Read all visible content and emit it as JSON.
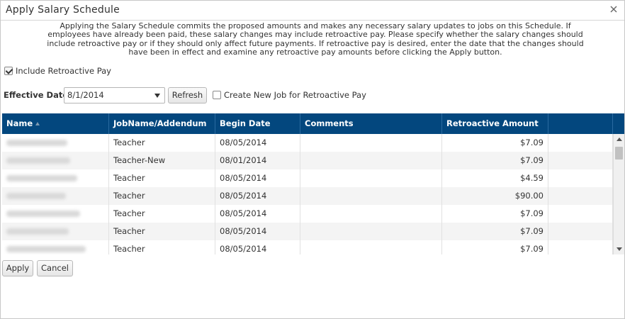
{
  "dialog": {
    "title": "Apply Salary Schedule",
    "close_icon": "close-icon"
  },
  "intro": {
    "line1": "Applying the Salary Schedule commits the proposed amounts and makes any necessary salary updates to jobs on this Schedule. If",
    "line2": "employees have already been paid, these salary changes may include retroactive pay. Please specify whether the salary changes should",
    "line3": "include retroactive pay or if they should only affect future payments. If retroactive pay is desired, enter the date that the changes should",
    "line4": "have been in effect and examine any retroactive pay amounts before clicking the Apply button."
  },
  "options": {
    "include_retro_label": "Include Retroactive Pay",
    "include_retro_checked": true,
    "effective_date_label": "Effective Date:",
    "effective_date_value": "8/1/2014",
    "refresh_label": "Refresh",
    "create_job_label": "Create New Job for Retroactive Pay",
    "create_job_checked": false
  },
  "grid": {
    "header_color": "#03477e",
    "columns": [
      {
        "label": "Name",
        "sorted": "ascending"
      },
      {
        "label": "JobName/Addendum"
      },
      {
        "label": "Begin Date"
      },
      {
        "label": "Comments"
      },
      {
        "label": "Retroactive Amount"
      }
    ],
    "rows": [
      {
        "name": "",
        "job": "Teacher",
        "begin": "08/05/2014",
        "comments": "",
        "amount": "$7.09"
      },
      {
        "name": "",
        "job": "Teacher-New",
        "begin": "08/01/2014",
        "comments": "",
        "amount": "$7.09"
      },
      {
        "name": "",
        "job": "Teacher",
        "begin": "08/05/2014",
        "comments": "",
        "amount": "$4.59"
      },
      {
        "name": "",
        "job": "Teacher",
        "begin": "08/05/2014",
        "comments": "",
        "amount": "$90.00"
      },
      {
        "name": "",
        "job": "Teacher",
        "begin": "08/05/2014",
        "comments": "",
        "amount": "$7.09"
      },
      {
        "name": "",
        "job": "Teacher",
        "begin": "08/05/2014",
        "comments": "",
        "amount": "$7.09"
      },
      {
        "name": "",
        "job": "Teacher",
        "begin": "08/05/2014",
        "comments": "",
        "amount": "$7.09"
      }
    ]
  },
  "footer": {
    "apply_label": "Apply",
    "cancel_label": "Cancel"
  }
}
